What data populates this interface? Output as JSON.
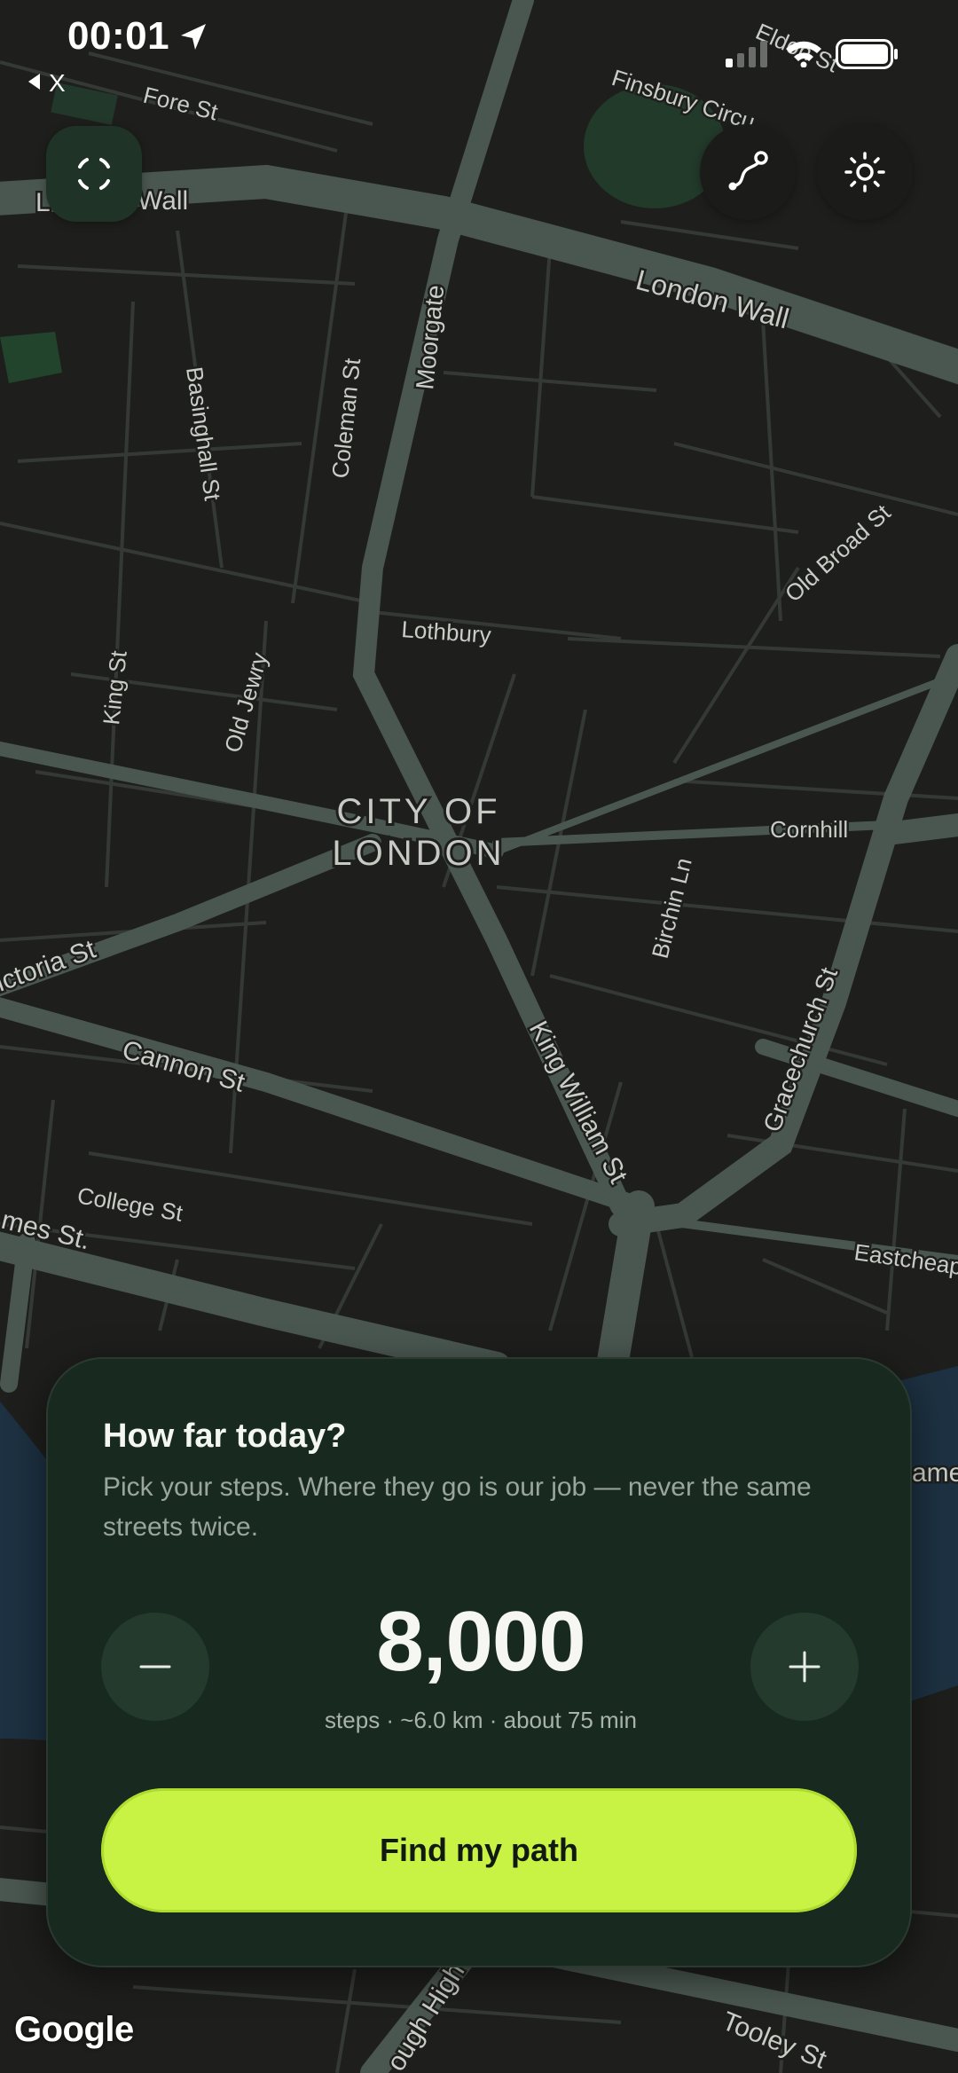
{
  "status_bar": {
    "time": "00:01",
    "back_label": "X"
  },
  "map": {
    "area_label_line1": "CITY OF",
    "area_label_line2": "LONDON",
    "streets": {
      "fore_st": "Fore St",
      "london_wall_left": "L",
      "london_wall_left2": "Wall",
      "london_wall": "London Wall",
      "finsbury_circus": "Finsbury Circu",
      "eldon_st": "Eldon St",
      "moorgate": "Moorgate",
      "coleman_st": "Coleman St",
      "basinghall_st": "Basinghall St",
      "old_broad_st": "Old Broad St",
      "lothbury": "Lothbury",
      "king_st": "King St",
      "old_jewry": "Old Jewry",
      "cornhill": "Cornhill",
      "birchin_ln": "Birchin Ln",
      "victoria_st": "ictoria St",
      "cannon_st": "Cannon St",
      "king_william_st": "King William St",
      "gracechurch_st": "Gracechurch St",
      "college_st": "College St",
      "thames_st": "mes St.",
      "eastcheap": "Eastcheap",
      "borough_high": "ough High",
      "tooley_st": "Tooley St",
      "right_edge": "ame"
    },
    "attribution": "Google"
  },
  "controls": {
    "recenter_icon": "recenter-icon",
    "route_icon": "route-icon",
    "theme_icon": "sun-icon"
  },
  "sheet": {
    "title": "How far today?",
    "subtitle": "Pick your steps. Where they go is our job — never the same streets twice.",
    "steps_value": "8,000",
    "steps_details": "steps · ~6.0 km · about 75 min",
    "minus_icon": "minus-icon",
    "plus_icon": "plus-icon",
    "cta_label": "Find my path"
  },
  "colors": {
    "accent": "#c8f244",
    "sheet_bg": "#182a20",
    "map_bg": "#1e1f1d",
    "major_road": "#4a5750",
    "minor_road": "#3a3d3a",
    "water": "#1d3142",
    "park": "#223a2a"
  }
}
